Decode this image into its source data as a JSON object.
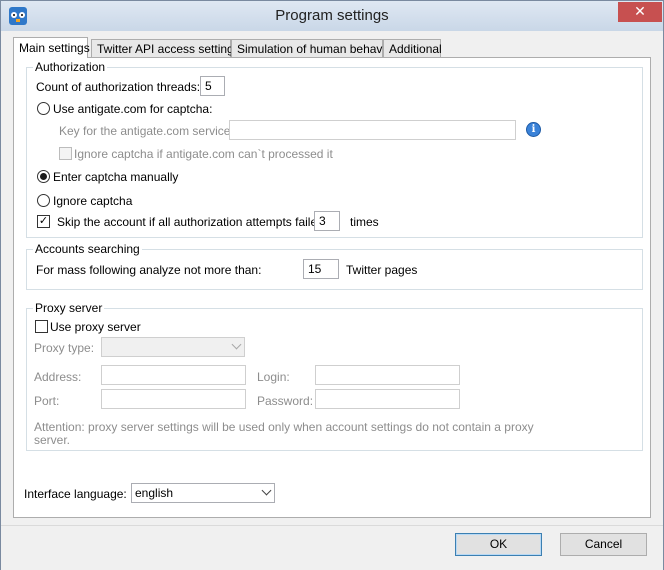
{
  "window": {
    "title": "Program settings",
    "close_label": "✕"
  },
  "tabs": [
    {
      "label": "Main settings",
      "active": true
    },
    {
      "label": "Twitter API access settings",
      "active": false
    },
    {
      "label": "Simulation of human behavior",
      "active": false
    },
    {
      "label": "Additional",
      "active": false
    }
  ],
  "authorization": {
    "legend": "Authorization",
    "threads_label": "Count of authorization threads:",
    "threads_value": "5",
    "antigate_label": "Use antigate.com for captcha:",
    "antigate_selected": false,
    "key_label": "Key for the antigate.com service:",
    "key_value": "",
    "ignore_if_fail_label": "Ignore captcha if antigate.com can`t processed it",
    "ignore_if_fail_checked": false,
    "manual_label": "Enter captcha manually",
    "manual_selected": true,
    "ignore_label": "Ignore captcha",
    "ignore_selected": false,
    "skip_label": "Skip the account if all authorization attempts failed:",
    "skip_checked": true,
    "skip_value": "3",
    "skip_suffix": "times"
  },
  "accounts": {
    "legend": "Accounts searching",
    "mass_label": "For mass following analyze not more than:",
    "mass_value": "15",
    "mass_suffix": "Twitter pages"
  },
  "proxy": {
    "legend": "Proxy server",
    "use_label": "Use proxy server",
    "use_checked": false,
    "type_label": "Proxy type:",
    "type_value": "",
    "address_label": "Address:",
    "address_value": "",
    "login_label": "Login:",
    "login_value": "",
    "port_label": "Port:",
    "port_value": "",
    "password_label": "Password:",
    "password_value": "",
    "attention_line1": "Attention: proxy server settings will be used only when account settings do not contain a proxy",
    "attention_line2": "server."
  },
  "language": {
    "label": "Interface language:",
    "value": "english"
  },
  "buttons": {
    "ok": "OK",
    "cancel": "Cancel"
  }
}
